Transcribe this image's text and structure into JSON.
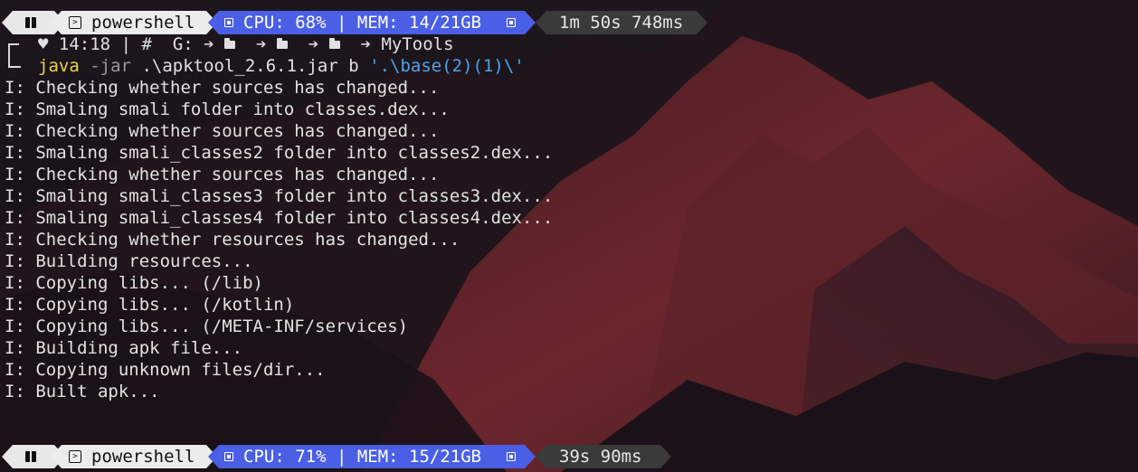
{
  "prompt_bars": [
    {
      "shell": "powershell",
      "sys": "CPU: 68% | MEM: 14/21GB",
      "duration": "1m 50s 748ms"
    },
    {
      "shell": "powershell",
      "sys": "CPU: 71% | MEM: 15/21GB",
      "duration": "39s 90ms"
    }
  ],
  "prompt_info": {
    "time": "14:18",
    "separator": "|",
    "hash": "#",
    "path_root": "G:",
    "path_leaf": "MyTools"
  },
  "command": {
    "program": "java",
    "flag": "-jar",
    "jar": ".\\apktool_2.6.1.jar",
    "subcommand": "b",
    "target": "'.\\base(2)(1)\\'"
  },
  "output_lines": [
    "I: Checking whether sources has changed...",
    "I: Smaling smali folder into classes.dex...",
    "I: Checking whether sources has changed...",
    "I: Smaling smali_classes2 folder into classes2.dex...",
    "I: Checking whether sources has changed...",
    "I: Smaling smali_classes3 folder into classes3.dex...",
    "I: Smaling smali_classes4 folder into classes4.dex...",
    "I: Checking whether resources has changed...",
    "I: Building resources...",
    "I: Copying libs... (/lib)",
    "I: Copying libs... (/kotlin)",
    "I: Copying libs... (/META-INF/services)",
    "I: Building apk file...",
    "I: Copying unknown files/dir...",
    "I: Built apk..."
  ],
  "colors": {
    "sys_segment": "#4a5fe6",
    "shell_segment": "#ececec",
    "time_segment": "#3a3a3a",
    "java_token": "#e8d44d",
    "string_token": "#4fa3e8"
  },
  "icons": {
    "os": "windows-icon",
    "shell": "terminal-icon",
    "sys": "chip-icon",
    "heart": "heart-icon",
    "folder": "folder-icon",
    "arrow": "arrow-right-icon"
  }
}
